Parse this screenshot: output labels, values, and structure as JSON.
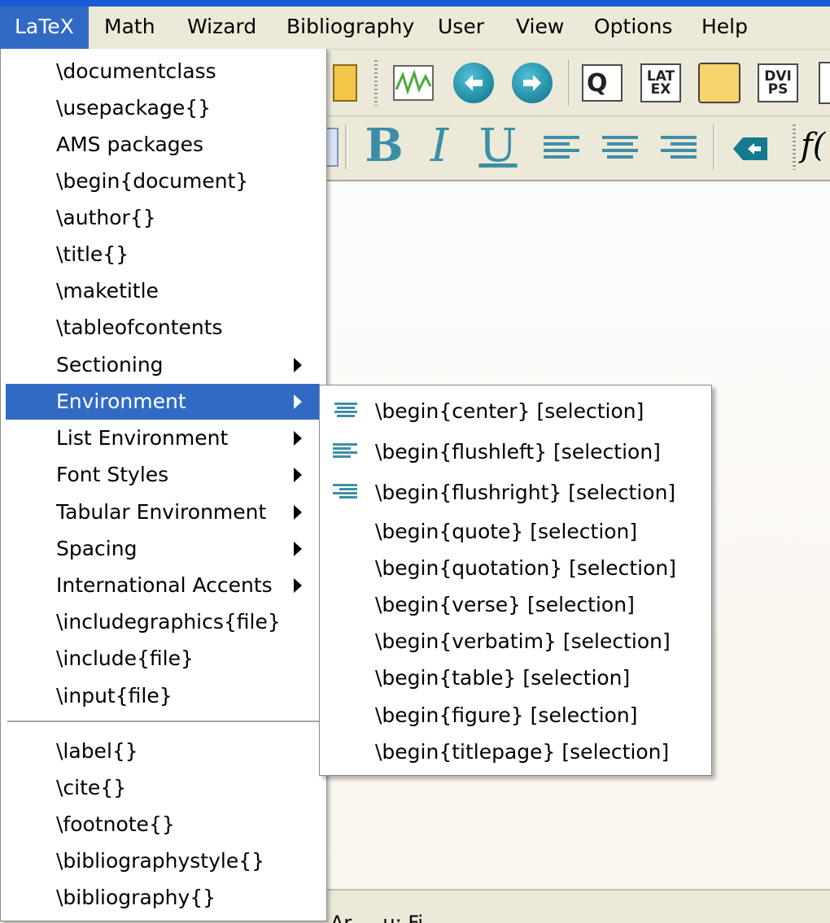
{
  "menubar": {
    "items": [
      "LaTeX",
      "Math",
      "Wizard",
      "Bibliography",
      "User",
      "View",
      "Options",
      "Help"
    ],
    "active": "LaTeX"
  },
  "toolbar": {
    "row1": [
      "Q",
      "LAT\nEX",
      "DVI\nPS"
    ],
    "row2": [
      "B",
      "I",
      "U",
      "f("
    ]
  },
  "latex_menu": {
    "items": [
      {
        "label": "\\documentclass"
      },
      {
        "label": "\\usepackage{}"
      },
      {
        "label": "AMS packages"
      },
      {
        "label": "\\begin{document}"
      },
      {
        "label": "\\author{}"
      },
      {
        "label": "\\title{}"
      },
      {
        "label": "\\maketitle"
      },
      {
        "label": "\\tableofcontents"
      },
      {
        "label": "Sectioning",
        "submenu": true
      },
      {
        "label": "Environment",
        "submenu": true,
        "highlighted": true
      },
      {
        "label": "List Environment",
        "submenu": true
      },
      {
        "label": "Font Styles",
        "submenu": true
      },
      {
        "label": "Tabular Environment",
        "submenu": true
      },
      {
        "label": "Spacing",
        "submenu": true
      },
      {
        "label": "International Accents",
        "submenu": true
      },
      {
        "label": "\\includegraphics{file}"
      },
      {
        "label": "\\include{file}"
      },
      {
        "label": "\\input{file}"
      }
    ],
    "items2": [
      {
        "label": "\\label{}"
      },
      {
        "label": "\\cite{}"
      },
      {
        "label": "\\footnote{}"
      },
      {
        "label": "\\bibliographystyle{}"
      },
      {
        "label": "\\bibliography{}"
      }
    ]
  },
  "environment_submenu": {
    "items": [
      {
        "label": "\\begin{center} [selection]",
        "icon": "align-center-icon"
      },
      {
        "label": "\\begin{flushleft} [selection]",
        "icon": "align-left-icon"
      },
      {
        "label": "\\begin{flushright}  [selection]",
        "icon": "align-right-icon"
      },
      {
        "label": "\\begin{quote}  [selection]"
      },
      {
        "label": "\\begin{quotation}  [selection]"
      },
      {
        "label": "\\begin{verse}  [selection]"
      },
      {
        "label": "\\begin{verbatim}  [selection]"
      },
      {
        "label": "\\begin{table}  [selection]"
      },
      {
        "label": "\\begin{figure}  [selection]"
      },
      {
        "label": "\\begin{titlepage}  [selection]"
      }
    ]
  },
  "statusbar": {
    "text": "Ar  ...  u: Fi"
  },
  "colors": {
    "highlight": "#316ac5",
    "menubar_bg": "#ece9d8",
    "titlebar": "#1c5bd6"
  }
}
